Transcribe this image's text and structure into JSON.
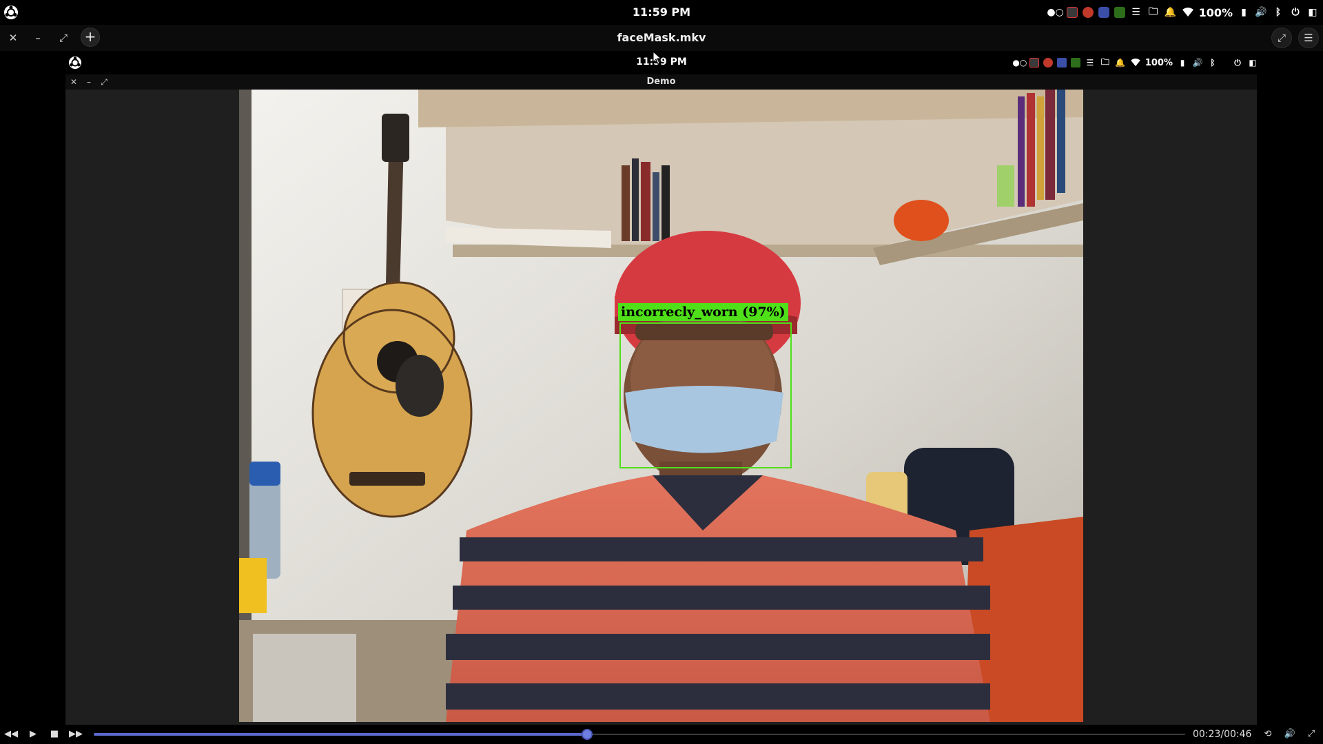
{
  "system_bar": {
    "clock": "11:59 PM",
    "battery": "100%"
  },
  "player": {
    "file_title": "faceMask.mkv",
    "new_tab_symbol": "+",
    "time_display": "00:23/00:46",
    "progress_fraction": 0.452
  },
  "recorded_desktop": {
    "clock": "11:59 PM",
    "battery": "100%",
    "window_title": "Demo"
  },
  "detection": {
    "label": "incorrecly_worn (97%)",
    "color": "#4fe019"
  },
  "icons": [
    "ubuntu-logo-icon",
    "close-icon",
    "minimize-icon",
    "maximize-icon",
    "plus-icon",
    "fullscreen-icon",
    "menu-icon",
    "rewind-icon",
    "play-icon",
    "stop-icon",
    "fast-forward-icon",
    "loop-icon",
    "volume-icon",
    "wifi-icon",
    "bell-icon",
    "power-icon",
    "bluetooth-icon",
    "folder-icon"
  ]
}
